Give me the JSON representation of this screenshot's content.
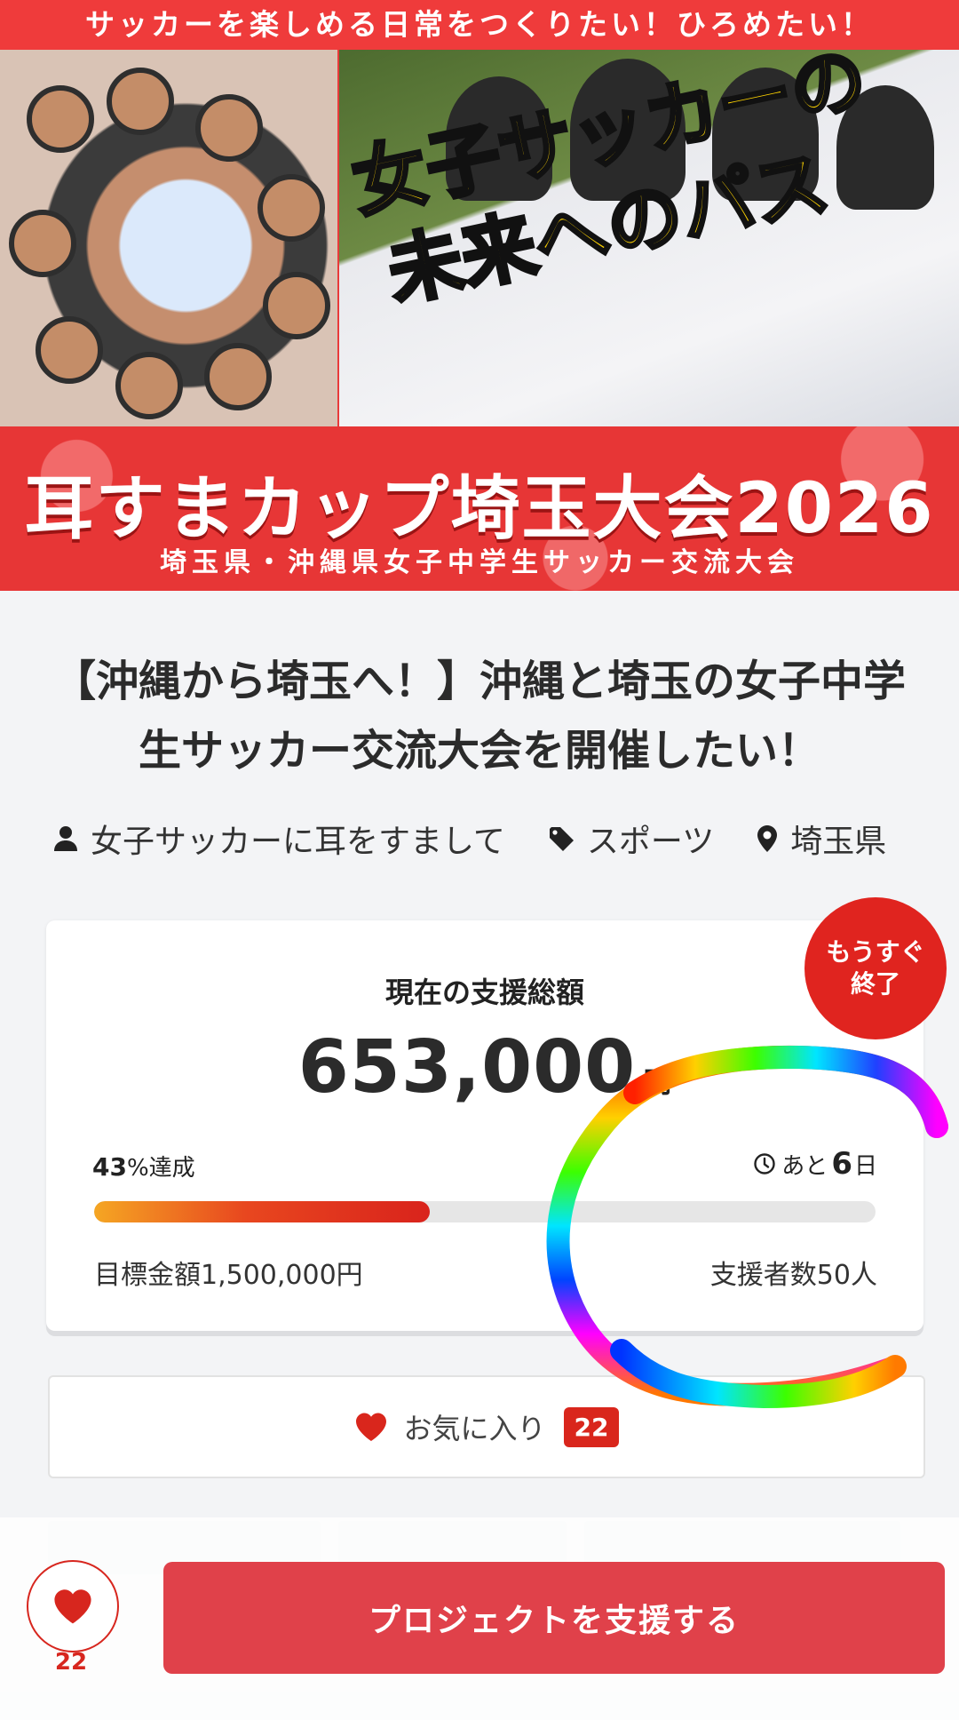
{
  "hero": {
    "top_caption": "サッカーを楽しめる日常をつくりたい！ひろめたい！",
    "catch_line1": "女子サッカーの",
    "catch_line2": "未来へのパス",
    "title": "耳すまカップ埼玉大会2026",
    "subtitle": "埼玉県・沖縄県女子中学生サッカー交流大会"
  },
  "project": {
    "title": "【沖縄から埼玉へ！】沖縄と埼玉の女子中学生サッカー交流大会を開催したい！",
    "owner": "女子サッカーに耳をすまして",
    "category": "スポーツ",
    "location": "埼玉県",
    "icons": {
      "owner": "user-icon",
      "category": "tag-icon",
      "location": "map-pin-icon"
    }
  },
  "funding": {
    "badge_line1": "もうすぐ",
    "badge_line2": "終了",
    "total_label": "現在の支援総額",
    "amount": "653,000",
    "amount_unit": "円",
    "percent": "43",
    "percent_suffix": "%達成",
    "progress_fraction": 0.43,
    "remaining_prefix": "あと",
    "remaining_days": "6",
    "remaining_unit": "日",
    "goal": "目標金額1,500,000円",
    "backers": "支援者数50人"
  },
  "favorite": {
    "label": "お気に入り",
    "count": "22"
  },
  "bottom_bar": {
    "like_count": "22",
    "support_button": "プロジェクトを支援する"
  },
  "colors": {
    "brand_red": "#e0241f",
    "button_red": "#e0414a",
    "progress_start": "#f5a623",
    "progress_end": "#d9231c"
  }
}
